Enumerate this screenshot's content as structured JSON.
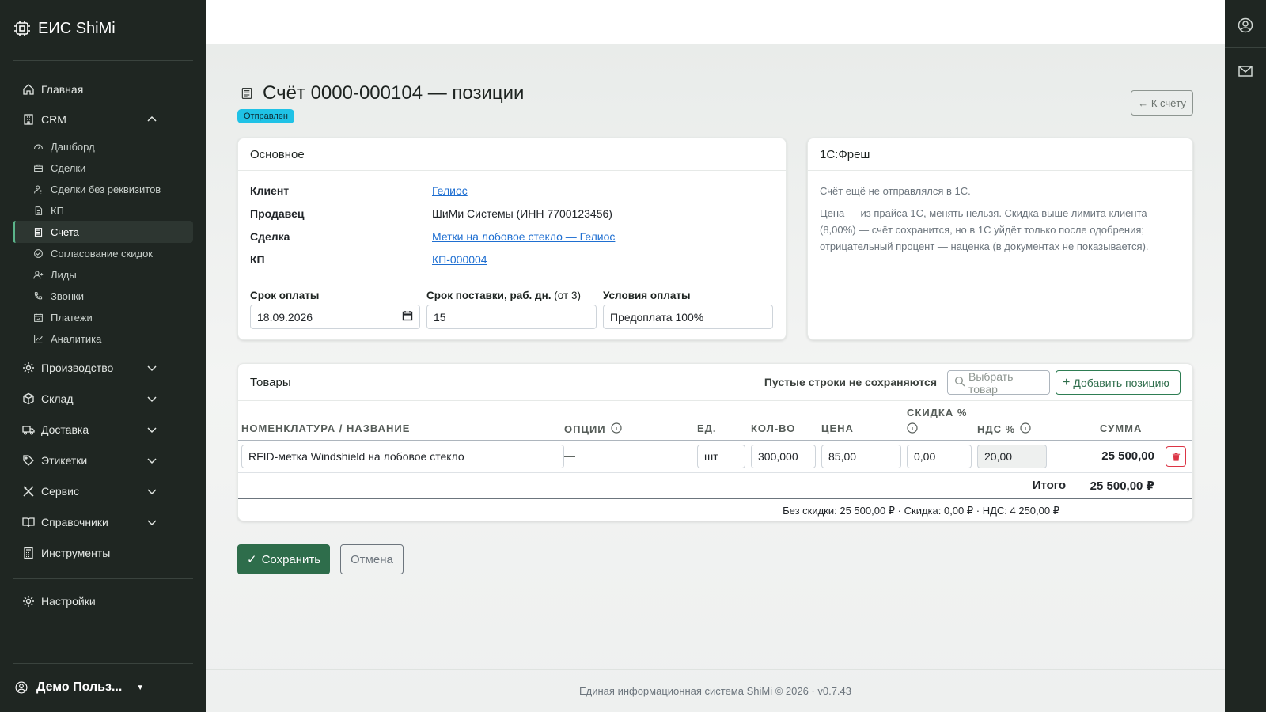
{
  "app": {
    "brand": "ЕИС ShiMi"
  },
  "sidebar": {
    "home": "Главная",
    "crm": "CRM",
    "crm_items": [
      "Дашборд",
      "Сделки",
      "Сделки без реквизитов",
      "КП",
      "Счета",
      "Согласование скидок",
      "Лиды",
      "Звонки",
      "Платежи",
      "Аналитика"
    ],
    "sections": [
      "Производство",
      "Склад",
      "Доставка",
      "Этикетки",
      "Сервис",
      "Справочники"
    ],
    "tools": "Инструменты",
    "settings": "Настройки",
    "user": "Демо Польз..."
  },
  "page": {
    "title": "Счёт 0000-000104 — позиции",
    "status": "Отправлен",
    "back_label": "← К счёту"
  },
  "main_card": {
    "header": "Основное",
    "client_label": "Клиент",
    "client_value": "Гелиос",
    "seller_label": "Продавец",
    "seller_value": "ШиМи Системы (ИНН 7700123456)",
    "deal_label": "Сделка",
    "deal_value": "Метки на лобовое стекло — Гелиос",
    "kp_label": "КП",
    "kp_value": "КП-000004",
    "due_label": "Срок оплаты",
    "due_value": "18.09.2026",
    "delivery_label": "Срок поставки, раб. дн.",
    "delivery_hint": "(от 3)",
    "delivery_value": "15",
    "terms_label": "Условия оплаты",
    "terms_value": "Предоплата 100%"
  },
  "onec_card": {
    "header": "1С:Фреш",
    "line1": "Счёт ещё не отправлялся в 1С.",
    "line2": "Цена — из прайса 1С, менять нельзя. Скидка выше лимита клиента (8,00%) — счёт сохранится, но в 1С уйдёт только после одобрения; отрицательный процент — наценка (в документах не показывается)."
  },
  "goods": {
    "header": "Товары",
    "note": "Пустые строки не сохраняются",
    "pick_label": "Выбрать товар",
    "add_label": "Добавить позицию",
    "columns": {
      "name": "НОМЕНКЛАТУРА / НАЗВАНИЕ",
      "options": "ОПЦИИ",
      "unit": "ЕД.",
      "qty": "КОЛ-ВО",
      "price": "ЦЕНА",
      "discount": "СКИДКА %",
      "vat": "НДС %",
      "sum": "СУММА"
    },
    "rows": [
      {
        "name": "RFID-метка Windshield на лобовое стекло",
        "options": "—",
        "unit": "шт",
        "qty": "300,000",
        "price": "85,00",
        "discount": "0,00",
        "vat": "20,00",
        "sum": "25 500,00"
      }
    ],
    "total_label": "Итого",
    "total_value": "25 500,00 ₽",
    "summary": "Без скидки: 25 500,00 ₽ · Скидка: 0,00 ₽ · НДС: 4 250,00 ₽"
  },
  "actions": {
    "save": "Сохранить",
    "cancel": "Отмена"
  },
  "footer": "Единая информационная система ShiMi © 2026 · v0.7.43"
}
